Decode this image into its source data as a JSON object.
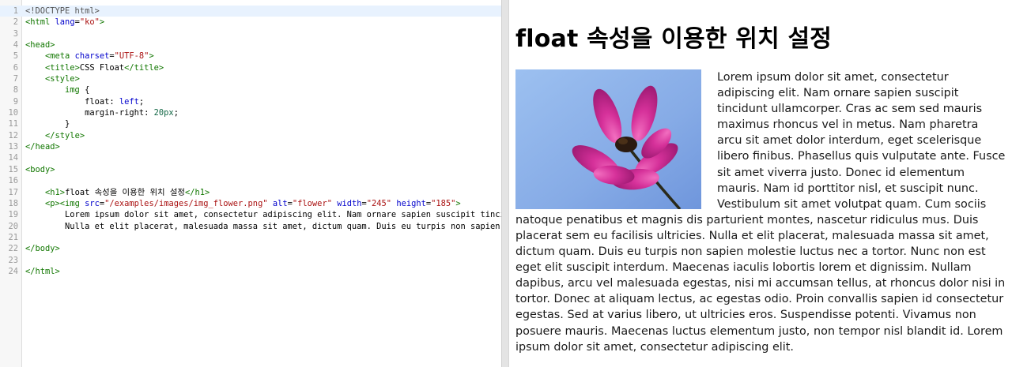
{
  "editor": {
    "lines": [
      {
        "n": "1",
        "html": "<span class='meta'>&lt;!DOCTYPE html&gt;</span>"
      },
      {
        "n": "2",
        "html": "<span class='tag'>&lt;html</span> <span class='attr'>lang</span>=<span class='str'>\"ko\"</span><span class='tag'>&gt;</span>"
      },
      {
        "n": "3",
        "html": ""
      },
      {
        "n": "4",
        "html": "<span class='tag'>&lt;head&gt;</span>"
      },
      {
        "n": "5",
        "html": "    <span class='tag'>&lt;meta</span> <span class='attr'>charset</span>=<span class='str'>\"UTF-8\"</span><span class='tag'>&gt;</span>"
      },
      {
        "n": "6",
        "html": "    <span class='tag'>&lt;title&gt;</span>CSS Float<span class='tag'>&lt;/title&gt;</span>"
      },
      {
        "n": "7",
        "html": "    <span class='tag'>&lt;style&gt;</span>"
      },
      {
        "n": "8",
        "html": "        <span class='tag'>img</span> {"
      },
      {
        "n": "9",
        "html": "            float: <span class='kw'>left</span>;"
      },
      {
        "n": "10",
        "html": "            margin-right: <span class='num-lit'>20px</span>;"
      },
      {
        "n": "11",
        "html": "        }"
      },
      {
        "n": "12",
        "html": "    <span class='tag'>&lt;/style&gt;</span>"
      },
      {
        "n": "13",
        "html": "<span class='tag'>&lt;/head&gt;</span>"
      },
      {
        "n": "14",
        "html": ""
      },
      {
        "n": "15",
        "html": "<span class='tag'>&lt;body&gt;</span>"
      },
      {
        "n": "16",
        "html": ""
      },
      {
        "n": "17",
        "html": "    <span class='tag'>&lt;h1&gt;</span>float 속성을 이용한 위치 설정<span class='tag'>&lt;/h1&gt;</span>"
      },
      {
        "n": "18",
        "html": "    <span class='tag'>&lt;p&gt;&lt;img</span> <span class='attr'>src</span>=<span class='str'>\"/examples/images/img_flower.png\"</span> <span class='attr'>alt</span>=<span class='str'>\"flower\"</span> <span class='attr'>width</span>=<span class='str'>\"245\"</span> <span class='attr'>height</span>=<span class='str'>\"185\"</span><span class='tag'>&gt;</span>"
      },
      {
        "n": "19",
        "html": "        Lorem ipsum dolor sit amet, consectetur adipiscing elit. Nam ornare sapien suscipit tincidunt"
      },
      {
        "n": "20",
        "html": "        Nulla et elit placerat, malesuada massa sit amet, dictum quam. Duis eu turpis non sapien"
      },
      {
        "n": "21",
        "html": ""
      },
      {
        "n": "22",
        "html": "<span class='tag'>&lt;/body&gt;</span>"
      },
      {
        "n": "23",
        "html": ""
      },
      {
        "n": "24",
        "html": "<span class='tag'>&lt;/html&gt;</span>"
      }
    ]
  },
  "preview": {
    "heading": "float 속성을 이용한 위치 설정",
    "image_alt": "flower",
    "paragraph": "Lorem ipsum dolor sit amet, consectetur adipiscing elit. Nam ornare sapien suscipit tincidunt ullamcorper. Cras ac sem sed mauris maximus rhoncus vel in metus. Nam pharetra arcu sit amet dolor interdum, eget scelerisque libero finibus. Phasellus quis vulputate ante. Fusce sit amet viverra justo. Donec id elementum mauris. Nam id porttitor nisl, et suscipit nunc. Vestibulum sit amet volutpat quam. Cum sociis natoque penatibus et magnis dis parturient montes, nascetur ridiculus mus. Duis placerat sem eu facilisis ultricies. Nulla et elit placerat, malesuada massa sit amet, dictum quam. Duis eu turpis non sapien molestie luctus nec a tortor. Nunc non est eget elit suscipit interdum. Maecenas iaculis lobortis lorem et dignissim. Nullam dapibus, arcu vel malesuada egestas, nisi mi accumsan tellus, at rhoncus dolor nisi in tortor. Donec at aliquam lectus, ac egestas odio. Proin convallis sapien id consectetur egestas. Sed at varius libero, ut ultricies eros. Suspendisse potenti. Vivamus non posuere mauris. Maecenas luctus elementum justo, non tempor nisl blandit id. Lorem ipsum dolor sit amet, consectetur adipiscing elit."
  },
  "colors": {
    "tag": "#117700",
    "attr": "#0000cc",
    "string": "#aa1111",
    "active_line": "#e8f2fe",
    "sky": "#8fb4ea",
    "petal": "#d8329a"
  }
}
